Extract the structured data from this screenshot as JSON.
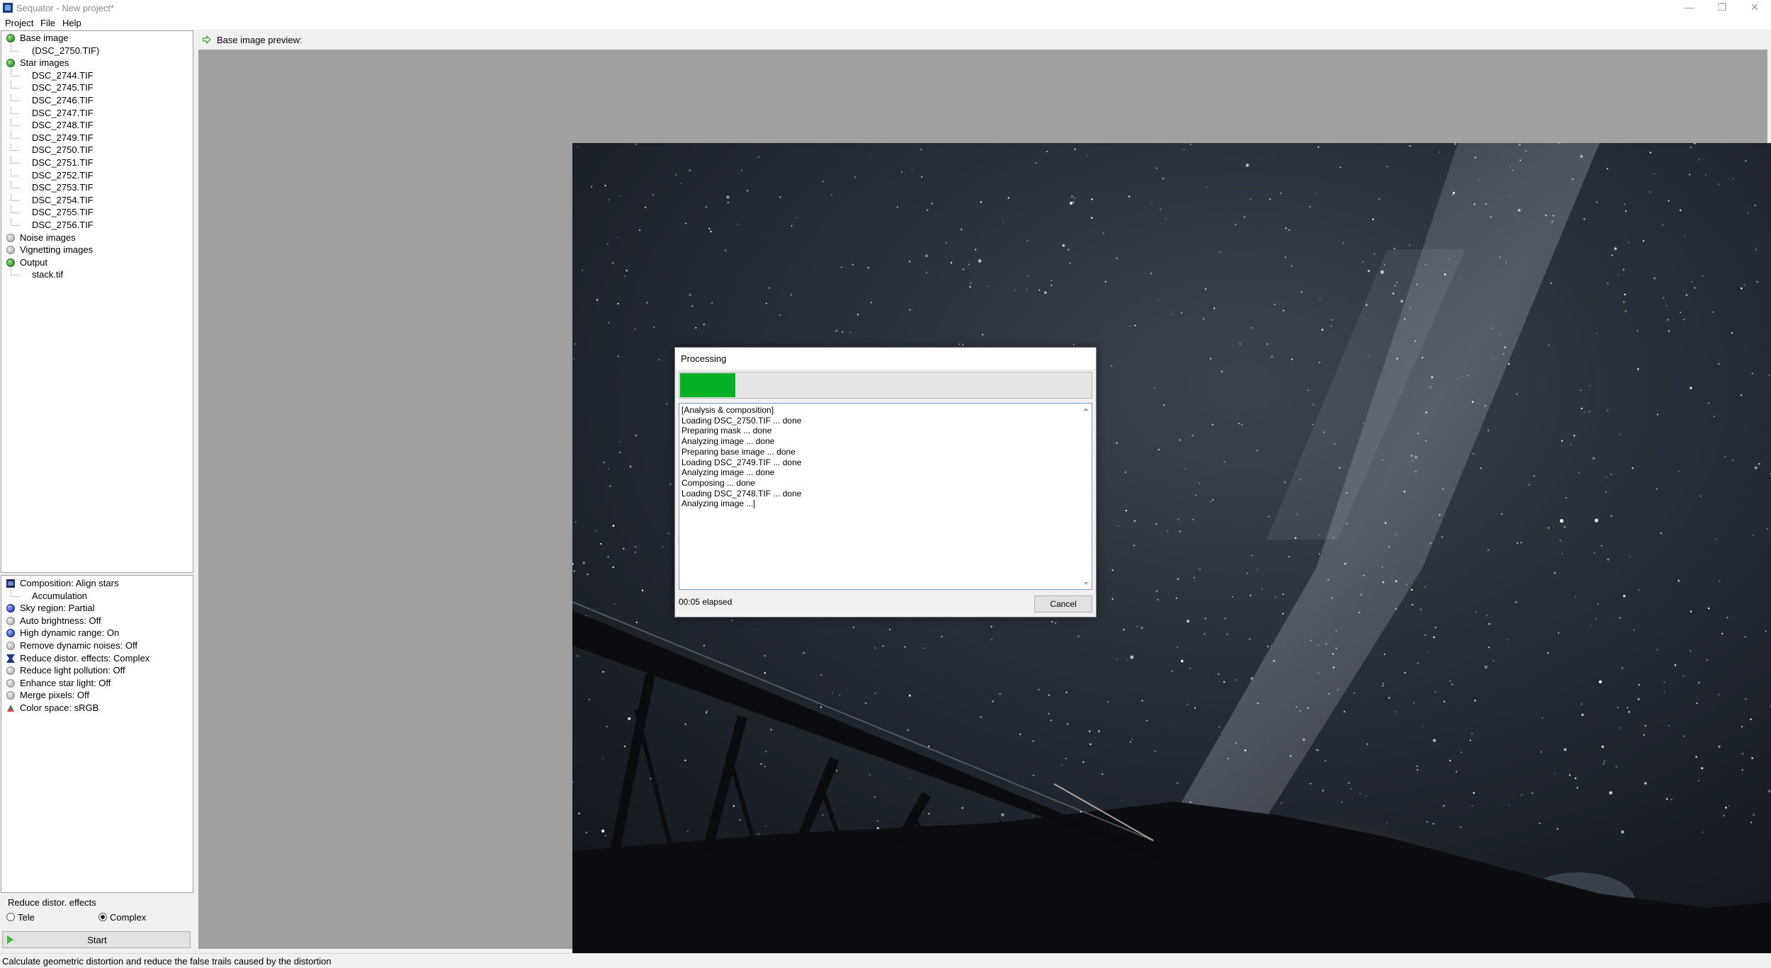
{
  "window": {
    "title": "Sequator - New project*",
    "controls": {
      "minimize": "—",
      "restore": "❐",
      "close": "✕"
    }
  },
  "menu": [
    "Project",
    "File",
    "Help"
  ],
  "project_tree": [
    {
      "label": "Base image",
      "icon": "green",
      "child": false
    },
    {
      "label": "(DSC_2750.TIF)",
      "child": true
    },
    {
      "label": "Star images",
      "icon": "green",
      "child": false
    },
    {
      "label": "DSC_2744.TIF",
      "child": true
    },
    {
      "label": "DSC_2745.TIF",
      "child": true
    },
    {
      "label": "DSC_2746.TIF",
      "child": true
    },
    {
      "label": "DSC_2747.TIF",
      "child": true
    },
    {
      "label": "DSC_2748.TIF",
      "child": true
    },
    {
      "label": "DSC_2749.TIF",
      "child": true
    },
    {
      "label": "DSC_2750.TIF",
      "child": true
    },
    {
      "label": "DSC_2751.TIF",
      "child": true
    },
    {
      "label": "DSC_2752.TIF",
      "child": true
    },
    {
      "label": "DSC_2753.TIF",
      "child": true
    },
    {
      "label": "DSC_2754.TIF",
      "child": true
    },
    {
      "label": "DSC_2755.TIF",
      "child": true
    },
    {
      "label": "DSC_2756.TIF",
      "child": true
    },
    {
      "label": "Noise images",
      "icon": "gray",
      "child": false
    },
    {
      "label": "Vignetting images",
      "icon": "gray",
      "child": false
    },
    {
      "label": "Output",
      "icon": "green",
      "child": false
    },
    {
      "label": "stack.tif",
      "child": true
    }
  ],
  "settings_list": [
    {
      "label": "Composition: Align stars",
      "icon": "composition",
      "child": false
    },
    {
      "label": "Accumulation",
      "child": true
    },
    {
      "label": "Sky region: Partial",
      "icon": "blue",
      "child": false
    },
    {
      "label": "Auto brightness: Off",
      "icon": "gray",
      "child": false
    },
    {
      "label": "High dynamic range: On",
      "icon": "blue",
      "child": false
    },
    {
      "label": "Remove dynamic noises: Off",
      "icon": "gray",
      "child": false
    },
    {
      "label": "Reduce distor. effects: Complex",
      "icon": "distortion",
      "child": false
    },
    {
      "label": "Reduce light pollution: Off",
      "icon": "gray",
      "child": false
    },
    {
      "label": "Enhance star light: Off",
      "icon": "gray",
      "child": false
    },
    {
      "label": "Merge pixels: Off",
      "icon": "gray",
      "child": false
    },
    {
      "label": "Color space: sRGB",
      "icon": "colorspace",
      "child": false
    }
  ],
  "options": {
    "group_label": "Reduce distor. effects",
    "radio_tele": "Tele",
    "radio_complex": "Complex",
    "selected": "Complex"
  },
  "start_label": "Start",
  "preview": {
    "header": "Base image preview:"
  },
  "status_bar": "Calculate geometric distortion and reduce the false trails caused by the distortion",
  "dialog": {
    "title": "Processing",
    "progress": 0.135,
    "progress_color": "#06b025",
    "log": [
      "[Analysis & composition]",
      "Loading DSC_2750.TIF ... done",
      "Preparing mask ... done",
      "Analyzing image ... done",
      "Preparing base image ... done",
      "Loading DSC_2749.TIF ... done",
      "Analyzing image ... done",
      "Composing ... done",
      "Loading DSC_2748.TIF ... done",
      "Analyzing image ..."
    ],
    "elapsed": "00:05 elapsed",
    "cancel_label": "Cancel"
  }
}
